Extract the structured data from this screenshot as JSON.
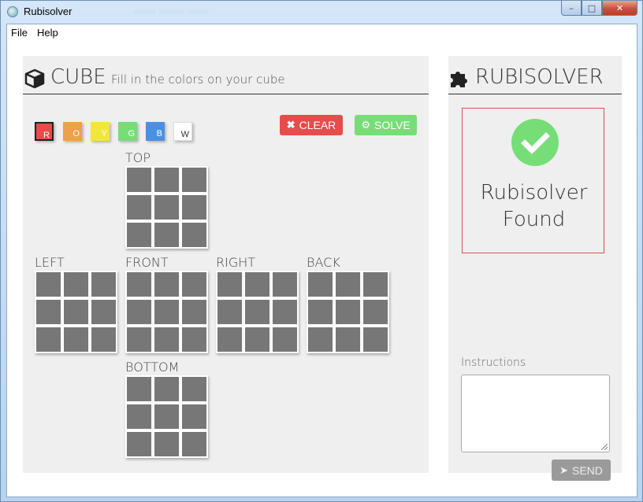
{
  "window": {
    "title": "Rubisolver",
    "blurred_tabs": "······  ·······  ······",
    "minimize": "–",
    "maximize": "□",
    "close": "✕"
  },
  "menu": {
    "file": "File",
    "help": "Help"
  },
  "cube_panel": {
    "title": "CUBE",
    "subtitle": "Fill in the colors on your cube",
    "swatches": [
      {
        "label": "R",
        "color": "#e84b4b",
        "selected": true
      },
      {
        "label": "O",
        "color": "#f0a04a"
      },
      {
        "label": "Y",
        "color": "#f2e63d"
      },
      {
        "label": "G",
        "color": "#77dd77"
      },
      {
        "label": "B",
        "color": "#4a90e2"
      },
      {
        "label": "W",
        "color": "#ffffff"
      }
    ],
    "clear_label": "CLEAR",
    "solve_label": "SOLVE",
    "faces": {
      "top": "TOP",
      "left": "LEFT",
      "front": "FRONT",
      "right": "RIGHT",
      "back": "BACK",
      "bottom": "BOTTOM"
    },
    "cell_color": "#777777"
  },
  "result_panel": {
    "title": "RUBISOLVER",
    "status_line1": "Rubisolver",
    "status_line2": "Found",
    "instructions_label": "Instructions",
    "instructions_value": "",
    "send_label": "SEND"
  },
  "icons": {
    "cube": "cube-icon",
    "puzzle": "puzzle-icon",
    "check": "check-icon",
    "times": "times-icon",
    "gear": "gear-icon",
    "send": "paper-plane-icon"
  }
}
